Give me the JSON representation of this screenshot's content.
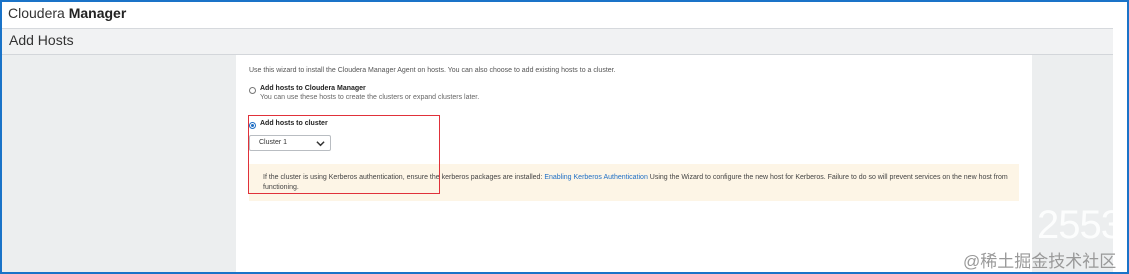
{
  "app": {
    "brand_light": "Cloudera ",
    "brand_bold": "Manager"
  },
  "page": {
    "title": "Add Hosts"
  },
  "wizard": {
    "intro": "Use this wizard to install the Cloudera Manager Agent on hosts. You can also choose to add existing hosts to a cluster.",
    "options": [
      {
        "title": "Add hosts to Cloudera Manager",
        "description": "You can use these hosts to create the clusters or expand clusters later.",
        "selected": false
      },
      {
        "title": "Add hosts to cluster",
        "selected": true
      }
    ],
    "cluster_select": {
      "value": "Cluster 1"
    },
    "notice": {
      "text_before": "If the cluster is using Kerberos authentication, ensure the kerberos packages are installed: ",
      "link": "Enabling Kerberos Authentication",
      "text_after": " Using the Wizard to configure the new host for Kerberos. Failure to do so will prevent services on the new host from functioning."
    }
  },
  "watermark": {
    "number": "2553",
    "text": "@稀土掘金技术社区"
  },
  "colors": {
    "frame_border": "#1a73c8",
    "highlight_box": "#e0313a",
    "link": "#1f6fc5",
    "notice_background": "#fdf5e6",
    "side_background": "#eceeef"
  }
}
